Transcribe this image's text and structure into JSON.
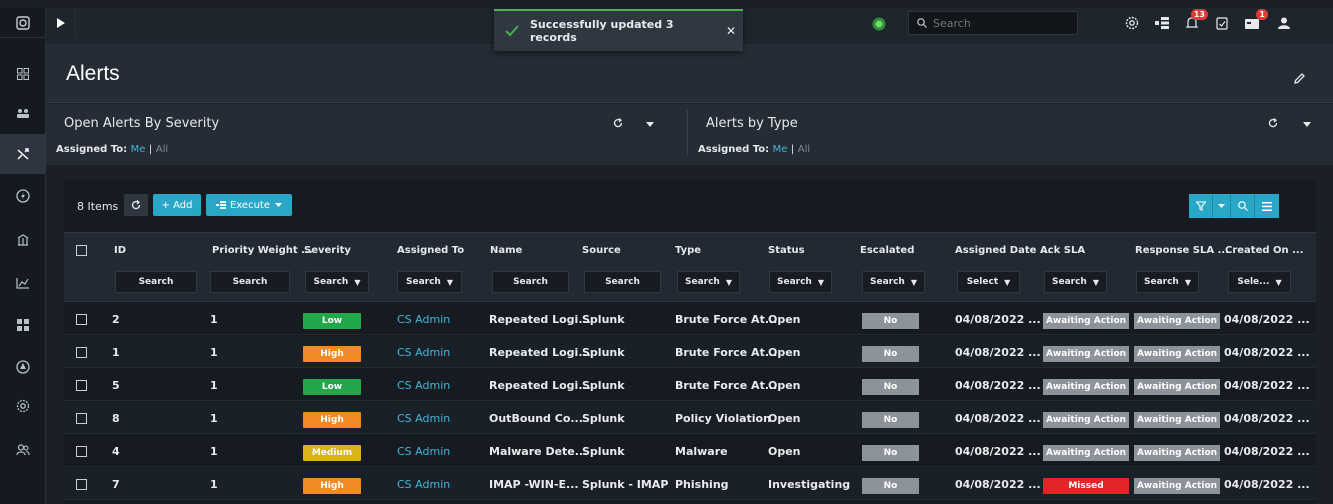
{
  "topbar": {
    "toast_message": "Successfully updated 3 records",
    "toast_close": "✕",
    "search_placeholder": "Search",
    "notifications_count": "13",
    "tasks_count": "1"
  },
  "page": {
    "title": "Alerts"
  },
  "widgets": [
    {
      "title": "Open Alerts By Severity",
      "assigned_label": "Assigned To:",
      "me": "Me",
      "sep": "|",
      "all": "All"
    },
    {
      "title": "Alerts by Type",
      "assigned_label": "Assigned To:",
      "me": "Me",
      "sep": "|",
      "all": "All"
    }
  ],
  "grid": {
    "items_count": "8 Items",
    "add_label": "+ Add",
    "execute_label": "Execute",
    "columns": [
      "ID",
      "Priority Weight ...",
      "Severity",
      "Assigned To",
      "Name",
      "Source",
      "Type",
      "Status",
      "Escalated",
      "Assigned Date ...",
      "Ack SLA",
      "Response SLA ...",
      "Created On ..."
    ],
    "filters": [
      "Search",
      "Search",
      "Search",
      "Search",
      "Search",
      "Search",
      "Search",
      "Search",
      "Search",
      "Select",
      "Search",
      "Search",
      "Sele..."
    ],
    "rows": [
      {
        "id": "2",
        "priority": "1",
        "severity": "Low",
        "assigned_to": "CS Admin",
        "name": "Repeated Logi...",
        "source": "Splunk",
        "type": "Brute Force At...",
        "status": "Open",
        "escalated": "No",
        "assigned_date": "04/08/2022 ...",
        "ack_sla": "Awaiting Action",
        "response_sla": "Awaiting Action",
        "created_on": "04/08/2022 ..."
      },
      {
        "id": "1",
        "priority": "1",
        "severity": "High",
        "assigned_to": "CS Admin",
        "name": "Repeated Logi...",
        "source": "Splunk",
        "type": "Brute Force At...",
        "status": "Open",
        "escalated": "No",
        "assigned_date": "04/08/2022 ...",
        "ack_sla": "Awaiting Action",
        "response_sla": "Awaiting Action",
        "created_on": "04/08/2022 ..."
      },
      {
        "id": "5",
        "priority": "1",
        "severity": "Low",
        "assigned_to": "CS Admin",
        "name": "Repeated Logi...",
        "source": "Splunk",
        "type": "Brute Force At...",
        "status": "Open",
        "escalated": "No",
        "assigned_date": "04/08/2022 ...",
        "ack_sla": "Awaiting Action",
        "response_sla": "Awaiting Action",
        "created_on": "04/08/2022 ..."
      },
      {
        "id": "8",
        "priority": "1",
        "severity": "High",
        "assigned_to": "CS Admin",
        "name": "OutBound Co...",
        "source": "Splunk",
        "type": "Policy Violation",
        "status": "Open",
        "escalated": "No",
        "assigned_date": "04/08/2022 ...",
        "ack_sla": "Awaiting Action",
        "response_sla": "Awaiting Action",
        "created_on": "04/08/2022 ..."
      },
      {
        "id": "4",
        "priority": "1",
        "severity": "Medium",
        "assigned_to": "CS Admin",
        "name": "Malware Dete...",
        "source": "Splunk",
        "type": "Malware",
        "status": "Open",
        "escalated": "No",
        "assigned_date": "04/08/2022 ...",
        "ack_sla": "Awaiting Action",
        "response_sla": "Awaiting Action",
        "created_on": "04/08/2022 ..."
      },
      {
        "id": "7",
        "priority": "1",
        "severity": "High",
        "assigned_to": "CS Admin",
        "name": "IMAP -WIN-E...",
        "source": "Splunk - IMAP",
        "type": "Phishing",
        "status": "Investigating",
        "escalated": "No",
        "assigned_date": "04/08/2022 ...",
        "ack_sla": "Missed",
        "response_sla": "Awaiting Action",
        "created_on": "04/08/2022 ..."
      }
    ]
  },
  "colors": {
    "accent": "#2aa7c6",
    "link": "#3fb7d6",
    "severity_low": "#22a84a",
    "severity_high": "#f08a24",
    "severity_medium": "#d9b31c",
    "sla_awaiting": "#8c939b",
    "sla_missed": "#e0262b",
    "toast_success": "#4caf50"
  }
}
